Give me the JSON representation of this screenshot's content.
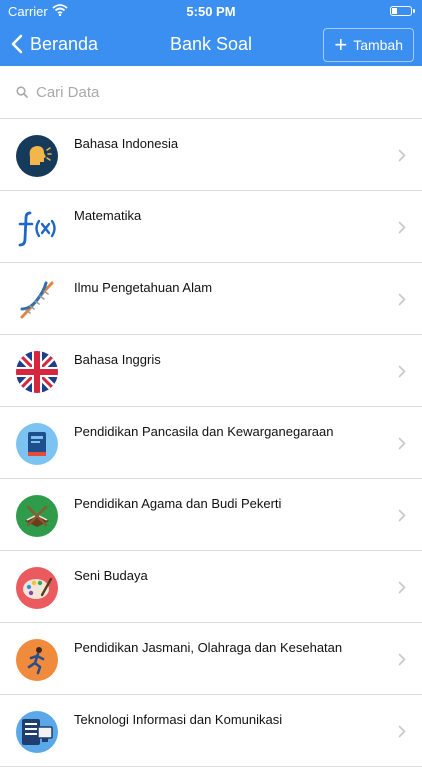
{
  "status_bar": {
    "carrier": "Carrier",
    "time": "5:50 PM"
  },
  "nav": {
    "back_label": "Beranda",
    "title": "Bank Soal",
    "add_label": "Tambah",
    "accent": "#3b8ff0"
  },
  "search": {
    "placeholder": "Cari Data",
    "value": ""
  },
  "subjects": [
    {
      "label": "Bahasa Indonesia",
      "icon": "speaking-head-icon"
    },
    {
      "label": "Matematika",
      "icon": "function-fx-icon"
    },
    {
      "label": "Ilmu Pengetahuan Alam",
      "icon": "dna-icon"
    },
    {
      "label": "Bahasa Inggris",
      "icon": "uk-flag-icon"
    },
    {
      "label": "Pendidikan Pancasila dan Kewarganegaraan",
      "icon": "book-icon"
    },
    {
      "label": "Pendidikan Agama dan Budi Pekerti",
      "icon": "quran-icon"
    },
    {
      "label": "Seni Budaya",
      "icon": "paint-palette-icon"
    },
    {
      "label": "Pendidikan Jasmani, Olahraga dan Kesehatan",
      "icon": "runner-icon"
    },
    {
      "label": "Teknologi Informasi dan Komunikasi",
      "icon": "computer-icon"
    }
  ]
}
